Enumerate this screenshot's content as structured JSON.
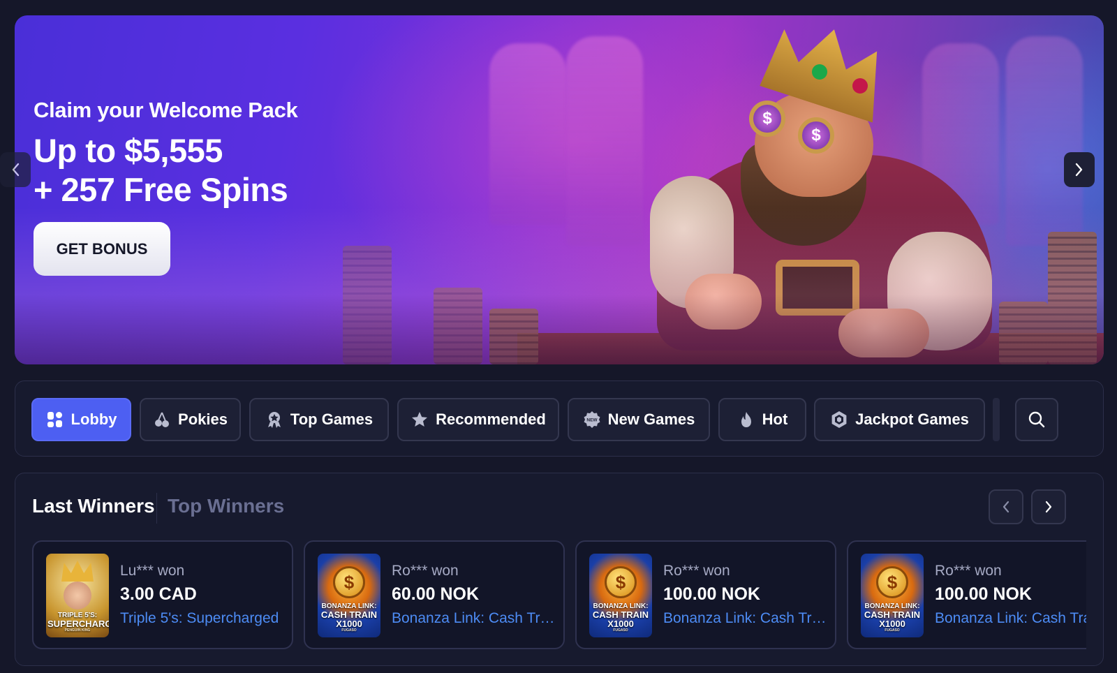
{
  "hero": {
    "subtitle": "Claim your Welcome Pack",
    "title_line1": "Up to $5,555",
    "title_line2": "+ 257 Free Spins",
    "cta_label": "GET BONUS",
    "prev_icon": "chevron-left-icon",
    "next_icon": "chevron-right-icon"
  },
  "categories": [
    {
      "label": "Lobby",
      "icon": "grid-icon",
      "active": true
    },
    {
      "label": "Pokies",
      "icon": "cherry-icon",
      "active": false
    },
    {
      "label": "Top Games",
      "icon": "award-icon",
      "active": false
    },
    {
      "label": "Recommended",
      "icon": "star-icon",
      "active": false
    },
    {
      "label": "New Games",
      "icon": "new-badge-icon",
      "active": false
    },
    {
      "label": "Hot",
      "icon": "flame-icon",
      "active": false
    },
    {
      "label": "Jackpot Games",
      "icon": "hexagon-icon",
      "active": false
    }
  ],
  "search": {
    "icon": "search-icon"
  },
  "winners": {
    "tab_last": "Last Winners",
    "tab_top": "Top Winners",
    "cards": [
      {
        "user": "Lu*** won",
        "amount": "3.00 CAD",
        "game": "Triple 5's: Supercharged",
        "thumb_line1": "TRIPLE 5'S:",
        "thumb_line2": "SUPERCHARGED",
        "thumb_line3": "PENGUIN KING"
      },
      {
        "user": "Ro*** won",
        "amount": "60.00 NOK",
        "game": "Bonanza Link: Cash Train",
        "thumb_line1": "BONANZA LINK:",
        "thumb_line2": "CASH TRAIN",
        "thumb_line3": "X1000",
        "thumb_line4": "FUGASO"
      },
      {
        "user": "Ro*** won",
        "amount": "100.00 NOK",
        "game": "Bonanza Link: Cash Train",
        "thumb_line1": "BONANZA LINK:",
        "thumb_line2": "CASH TRAIN",
        "thumb_line3": "X1000",
        "thumb_line4": "FUGASO"
      },
      {
        "user": "Ro*** won",
        "amount": "100.00 NOK",
        "game": "Bonanza Link: Cash Train",
        "thumb_line1": "BONANZA LINK:",
        "thumb_line2": "CASH TRAIN",
        "thumb_line3": "X1000",
        "thumb_line4": "FUGASO"
      }
    ]
  },
  "colors": {
    "background": "#151729",
    "panel": "#171a2e",
    "accent": "#4d5ff2",
    "link": "#4d8cf5",
    "muted": "#6a6f92"
  }
}
